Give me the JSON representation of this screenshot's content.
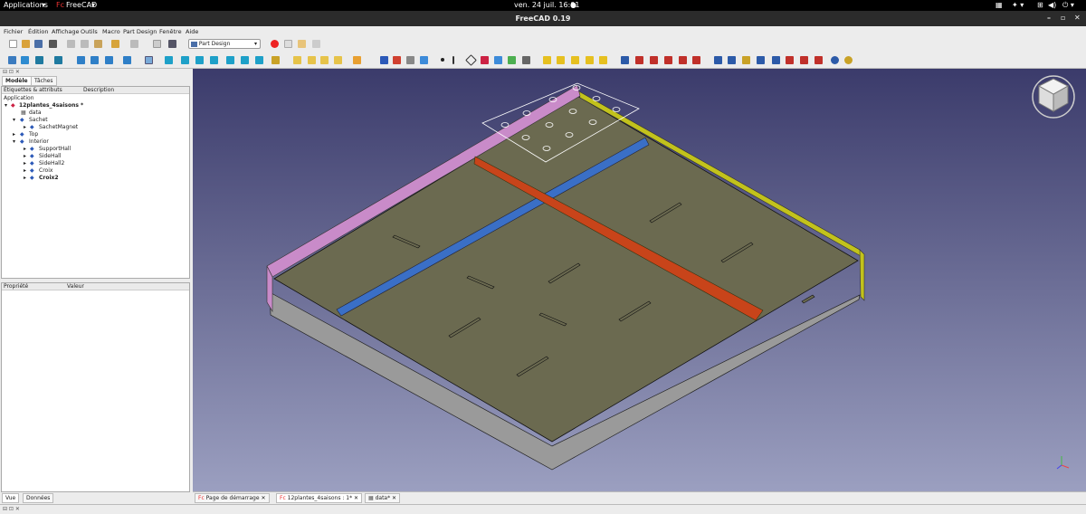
{
  "system": {
    "apps": "Applications",
    "app": "FreeCAD",
    "clock": "ven. 24 juil.  16:01"
  },
  "window": {
    "title": "FreeCAD 0.19"
  },
  "menu": [
    "Fichier",
    "Édition",
    "Affichage",
    "Outils",
    "Macro",
    "Part Design",
    "Fenêtre",
    "Aide"
  ],
  "workbench": "Part Design",
  "combo_tabs": [
    "Modèle",
    "Tâches"
  ],
  "tree": {
    "col_labels": "Étiquettes & attributs",
    "col_desc": "Description",
    "root": "Application",
    "items": [
      {
        "label": "12plantes_4saisons *",
        "bold": true
      },
      {
        "label": "data"
      },
      {
        "label": "Sachet"
      },
      {
        "label": "SachetMagnet"
      },
      {
        "label": "Top"
      },
      {
        "label": "Interior"
      },
      {
        "label": "SupportHall"
      },
      {
        "label": "SideHall"
      },
      {
        "label": "SideHall2"
      },
      {
        "label": "Croix"
      },
      {
        "label": "Croix2",
        "bold": true
      }
    ]
  },
  "props": {
    "col_prop": "Propriété",
    "col_val": "Valeur"
  },
  "view_tabs": [
    "Vue",
    "Données"
  ],
  "doc_tabs": [
    "Page de démarrage",
    "12plantes_4saisons : 1*",
    "data*"
  ],
  "colors": {
    "pink": "#c98bc9",
    "yellow": "#c2c21c",
    "blue": "#3a6fc6",
    "orange": "#c8441a",
    "plate": "#6b6a50"
  }
}
